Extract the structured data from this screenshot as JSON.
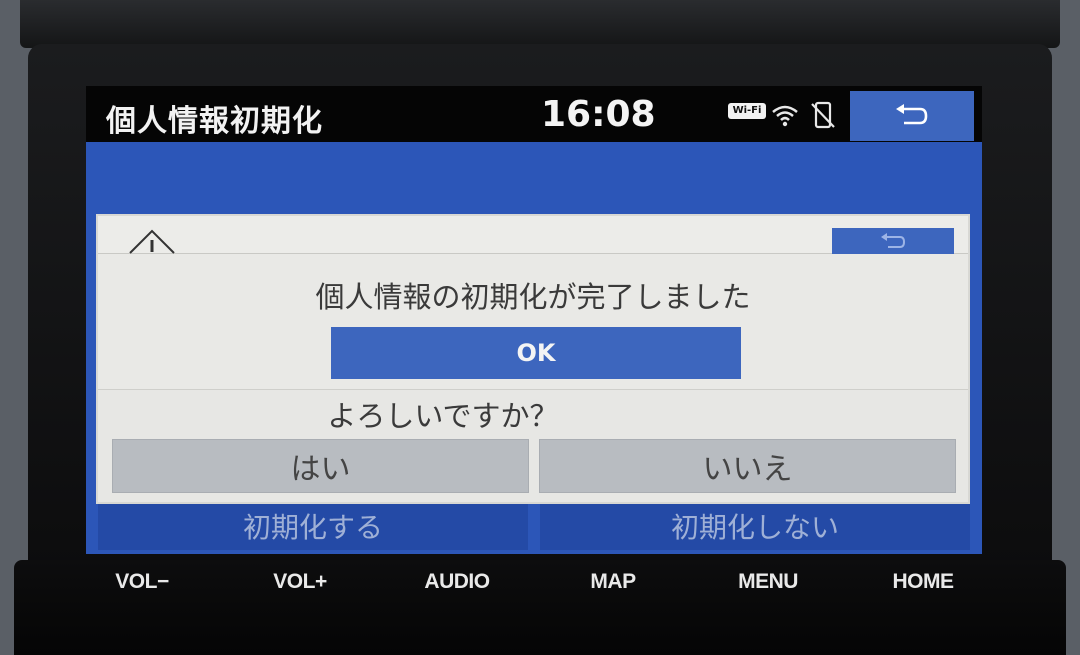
{
  "status_bar": {
    "title": "個人情報初期化",
    "time": "16:08",
    "wifi_badge": "Wi-Fi"
  },
  "dialog": {
    "message": "個人情報の初期化が完了しました",
    "ok_label": "OK",
    "question": "よろしいですか？",
    "yes_label": "はい",
    "no_label": "いいえ"
  },
  "background": {
    "initialize_label": "初期化する",
    "no_initialize_label": "初期化しない"
  },
  "hardware_buttons": [
    "VOL−",
    "VOL+",
    "AUDIO",
    "MAP",
    "MENU",
    "HOME"
  ],
  "icons": {
    "back": "back-arrow-icon",
    "wifi": "wifi-signal-icon",
    "phone": "phone-disconnected-icon",
    "warning": "warning-icon"
  },
  "colors": {
    "accent_blue": "#3d66be",
    "screen_blue": "#2c56b8",
    "dialog_bg": "#e7e7e4",
    "answer_bg": "#b8bcc1"
  }
}
